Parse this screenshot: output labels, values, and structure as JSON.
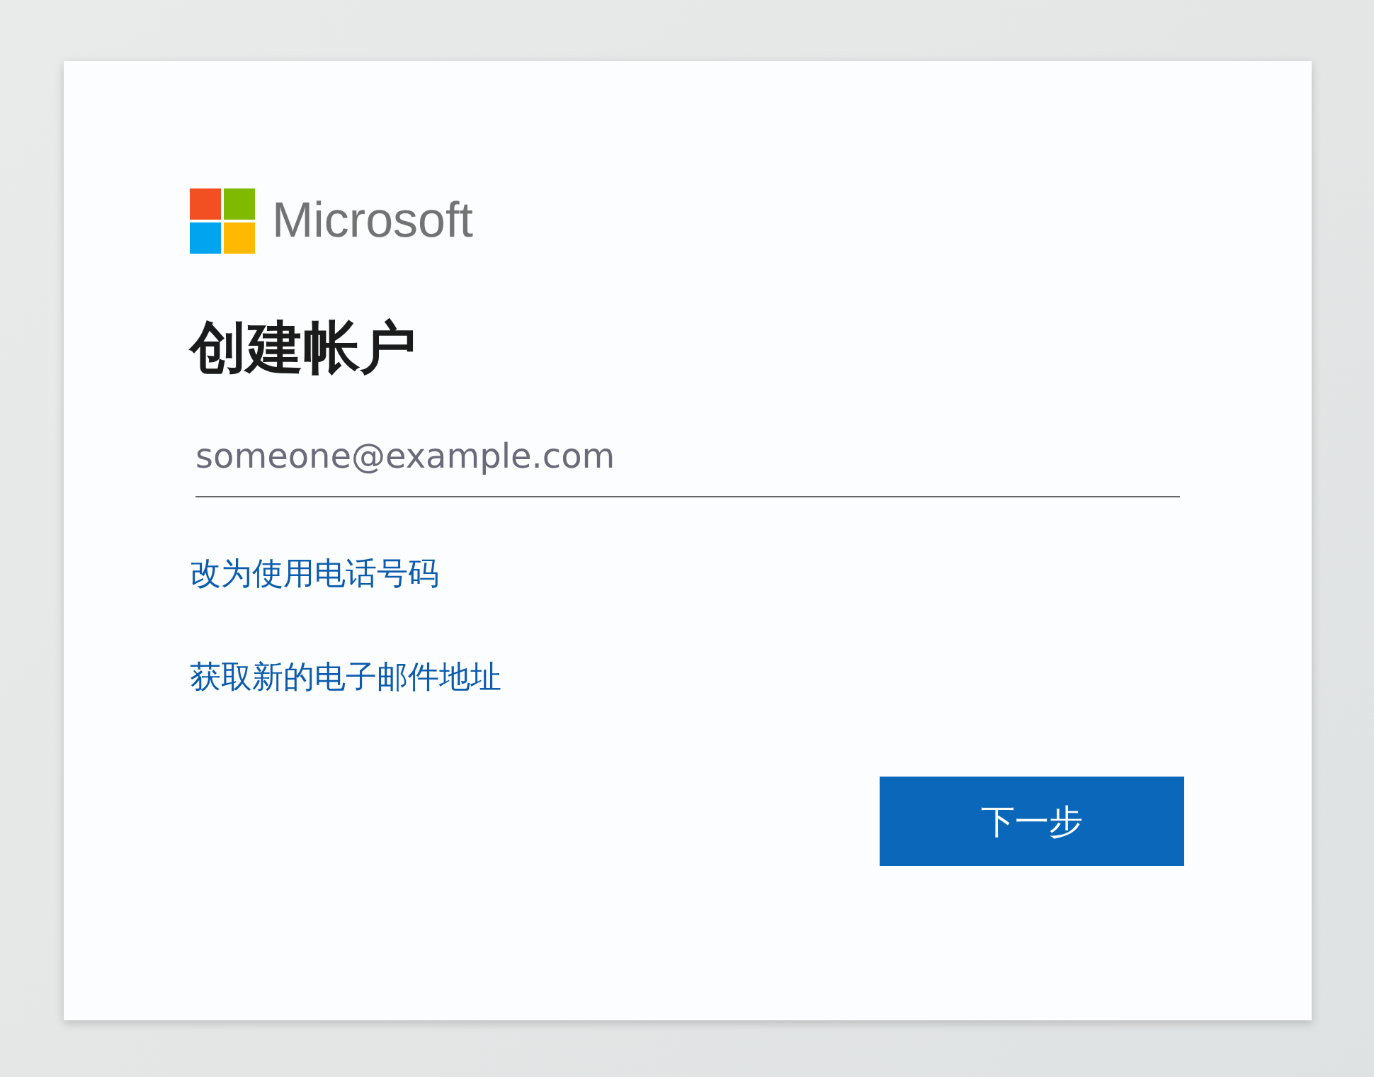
{
  "logo": {
    "text": "Microsoft"
  },
  "title": "创建帐户",
  "email_field": {
    "placeholder": "someone@example.com"
  },
  "links": [
    "改为使用电话号码",
    "获取新的电子邮件地址"
  ],
  "next_button": {
    "label": "下一步"
  }
}
